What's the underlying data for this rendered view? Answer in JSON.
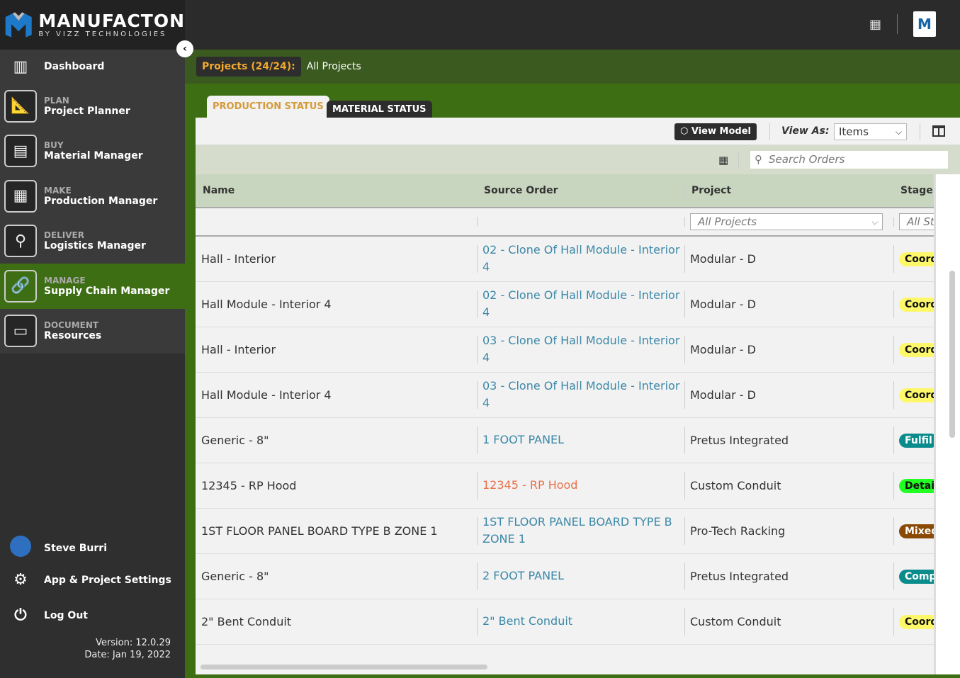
{
  "brand": {
    "name": "MANUFACTON",
    "tagline": "BY VIZZ TECHNOLOGIES"
  },
  "sidebar": {
    "items": [
      {
        "section": "",
        "label": "Dashboard",
        "icon": "dashboard-icon"
      },
      {
        "section": "PLAN",
        "label": "Project Planner",
        "icon": "planner-icon"
      },
      {
        "section": "BUY",
        "label": "Material Manager",
        "icon": "material-icon"
      },
      {
        "section": "MAKE",
        "label": "Production Manager",
        "icon": "factory-icon"
      },
      {
        "section": "DELIVER",
        "label": "Logistics Manager",
        "icon": "map-pin-icon"
      },
      {
        "section": "MANAGE",
        "label": "Supply Chain Manager",
        "icon": "link-icon",
        "active": true
      },
      {
        "section": "DOCUMENT",
        "label": "Resources",
        "icon": "archive-icon"
      }
    ],
    "user": "Steve Burri",
    "settings": "App & Project Settings",
    "logout": "Log Out",
    "version": "Version: 12.0.29",
    "date": "Date: Jan 19, 2022"
  },
  "breadcrumb": {
    "projects": "Projects (24/24):",
    "current": "All Projects"
  },
  "tabs": [
    "PRODUCTION STATUS",
    "MATERIAL STATUS"
  ],
  "toolbar": {
    "view_model": "View Model",
    "view_as_label": "View As:",
    "view_as_value": "Items",
    "search_placeholder": "Search Orders"
  },
  "table": {
    "headers": [
      "Name",
      "Source Order",
      "Project",
      "Stage"
    ],
    "filters": {
      "project": "All Projects",
      "stage": "All St"
    },
    "rows": [
      {
        "name": "Hall - Interior",
        "source": "02 - Clone Of Hall Module - Interior 4",
        "project": "Modular - D",
        "stage": "Coord",
        "stage_color": "#fdf86a",
        "stage_text": "#111"
      },
      {
        "name": "Hall Module - Interior 4",
        "source": "02 - Clone Of Hall Module - Interior 4",
        "project": "Modular - D",
        "stage": "Coord",
        "stage_color": "#fdf86a",
        "stage_text": "#111"
      },
      {
        "name": "Hall - Interior",
        "source": "03 - Clone Of Hall Module - Interior 4",
        "project": "Modular - D",
        "stage": "Coord",
        "stage_color": "#fdf86a",
        "stage_text": "#111"
      },
      {
        "name": "Hall Module - Interior 4",
        "source": "03 - Clone Of Hall Module - Interior 4",
        "project": "Modular - D",
        "stage": "Coord",
        "stage_color": "#fdf86a",
        "stage_text": "#111"
      },
      {
        "name": "Generic - 8\"",
        "source": "1 FOOT PANEL",
        "project": "Pretus Integrated",
        "stage": "Fulfil",
        "stage_color": "#0b8c8c",
        "stage_text": "#fff"
      },
      {
        "name": "12345 - RP Hood",
        "source": "12345 - RP Hood",
        "source_warn": true,
        "project": "Custom Conduit",
        "stage": "Detai",
        "stage_color": "#22ff22",
        "stage_text": "#111"
      },
      {
        "name": "1ST FLOOR PANEL BOARD TYPE B ZONE 1",
        "source": "1ST FLOOR PANEL BOARD TYPE B ZONE 1",
        "project": "Pro-Tech Racking",
        "stage": "Mixed",
        "stage_color": "#8a4a06",
        "stage_text": "#fff"
      },
      {
        "name": "Generic - 8\"",
        "source": "2 FOOT PANEL",
        "project": "Pretus Integrated",
        "stage": "Comp",
        "stage_color": "#0b8c8c",
        "stage_text": "#fff"
      },
      {
        "name": "2\" Bent Conduit",
        "source": "2\" Bent Conduit",
        "project": "Custom Conduit",
        "stage": "Coord",
        "stage_color": "#fdf86a",
        "stage_text": "#111"
      }
    ]
  }
}
